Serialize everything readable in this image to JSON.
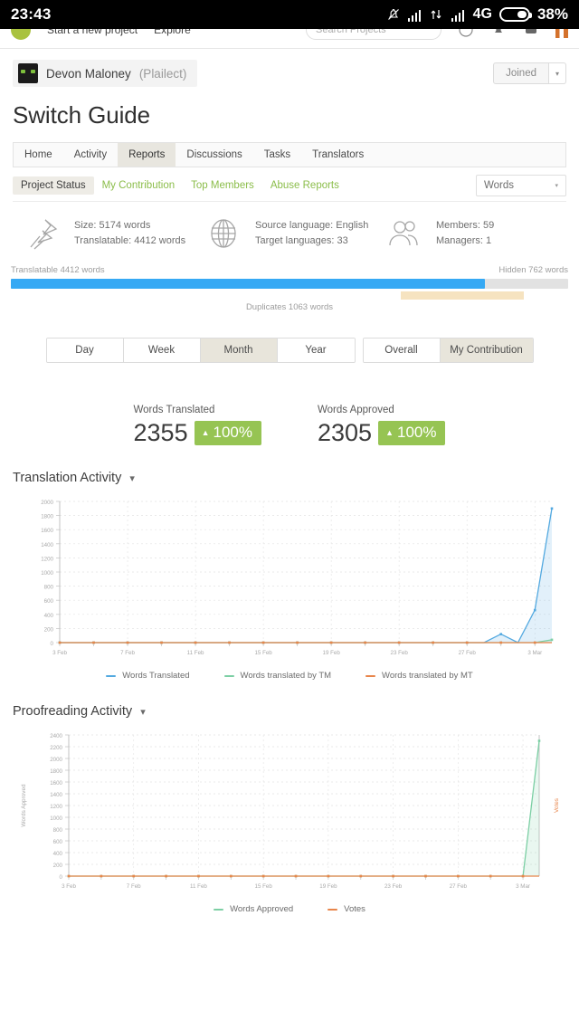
{
  "statusbar": {
    "time": "23:43",
    "network": "4G",
    "battery": "38%",
    "icons": [
      "mute-bell-icon",
      "signal-bars-icon",
      "data-transfer-icon",
      "signal-bars-icon",
      "battery-icon"
    ]
  },
  "topnav": {
    "brand": "crowdin-logo",
    "links": [
      "Start a new project",
      "Explore"
    ],
    "search_placeholder": "Search Projects",
    "icons": [
      "help-icon",
      "notifications-icon",
      "messages-icon",
      "flag-icon"
    ]
  },
  "owner": {
    "name": "Devon Maloney",
    "handle": "(Plailect)",
    "joined_label": "Joined",
    "caret": "▾"
  },
  "page": {
    "title": "Switch Guide"
  },
  "tabs": [
    {
      "label": "Home",
      "active": false
    },
    {
      "label": "Activity",
      "active": false
    },
    {
      "label": "Reports",
      "active": true
    },
    {
      "label": "Discussions",
      "active": false
    },
    {
      "label": "Tasks",
      "active": false
    },
    {
      "label": "Translators",
      "active": false
    }
  ],
  "subtabs": [
    {
      "label": "Project Status",
      "active": true
    },
    {
      "label": "My Contribution",
      "active": false
    },
    {
      "label": "Top Members",
      "active": false
    },
    {
      "label": "Abuse Reports",
      "active": false
    }
  ],
  "unit_select": {
    "value": "Words",
    "caret": "▾"
  },
  "stats": [
    {
      "icon": "ruler-pencil-icon",
      "line1": "Size: 5174 words",
      "line2": "Translatable: 4412 words"
    },
    {
      "icon": "globe-icon",
      "line1": "Source language: English",
      "line2": "Target languages: 33"
    },
    {
      "icon": "members-icon",
      "line1": "Members: 59",
      "line2": "Managers: 1"
    }
  ],
  "progress": {
    "left_label": "Translatable 4412 words",
    "right_label": "Hidden 762 words",
    "fill_percent": 85,
    "duplicates_label": "Duplicates 1063 words",
    "duplicates_start_percent": 70,
    "duplicates_width_percent": 22,
    "fill_color": "#36a9f4",
    "track_color": "#e2e2e2",
    "duplicates_color": "#f6e3c0"
  },
  "period_toggles": [
    {
      "label": "Day",
      "active": false
    },
    {
      "label": "Week",
      "active": false
    },
    {
      "label": "Month",
      "active": true
    },
    {
      "label": "Year",
      "active": false
    }
  ],
  "scope_toggles": [
    {
      "label": "Overall",
      "active": false
    },
    {
      "label": "My Contribution",
      "active": true
    }
  ],
  "kpis": [
    {
      "label": "Words Translated",
      "value": "2355",
      "delta": "100%",
      "arrow": "▲",
      "color": "#96c453"
    },
    {
      "label": "Words Approved",
      "value": "2305",
      "delta": "100%",
      "arrow": "▲",
      "color": "#96c453"
    }
  ],
  "chart_data": [
    {
      "type": "line",
      "title": "Translation Activity",
      "chevron": "⌄",
      "xlabel": "",
      "ylabel": "",
      "ylim": [
        0,
        2000
      ],
      "yticks": [
        0,
        200,
        400,
        600,
        800,
        1000,
        1200,
        1400,
        1600,
        1800,
        2000
      ],
      "xticklabels": [
        "3 Feb",
        "7 Feb",
        "11 Feb",
        "15 Feb",
        "19 Feb",
        "23 Feb",
        "27 Feb",
        "3 Mar"
      ],
      "x": [
        "3 Feb",
        "4 Feb",
        "5 Feb",
        "6 Feb",
        "7 Feb",
        "8 Feb",
        "9 Feb",
        "10 Feb",
        "11 Feb",
        "12 Feb",
        "13 Feb",
        "14 Feb",
        "15 Feb",
        "16 Feb",
        "17 Feb",
        "18 Feb",
        "19 Feb",
        "20 Feb",
        "21 Feb",
        "22 Feb",
        "23 Feb",
        "24 Feb",
        "25 Feb",
        "26 Feb",
        "27 Feb",
        "28 Feb",
        "1 Mar",
        "2 Mar",
        "3 Mar",
        "4 Mar"
      ],
      "grid": true,
      "legend_position": "bottom",
      "series": [
        {
          "name": "Words Translated",
          "color": "#53a9e0",
          "values": [
            0,
            0,
            0,
            0,
            0,
            0,
            0,
            0,
            0,
            0,
            0,
            0,
            0,
            0,
            0,
            0,
            0,
            0,
            0,
            0,
            0,
            0,
            0,
            0,
            0,
            0,
            120,
            0,
            460,
            1900
          ]
        },
        {
          "name": "Words translated by TM",
          "color": "#7ccfa4",
          "values": [
            0,
            0,
            0,
            0,
            0,
            0,
            0,
            0,
            0,
            0,
            0,
            0,
            0,
            0,
            0,
            0,
            0,
            0,
            0,
            0,
            0,
            0,
            0,
            0,
            0,
            0,
            0,
            0,
            0,
            40
          ]
        },
        {
          "name": "Words translated by MT",
          "color": "#e8854a",
          "values": [
            0,
            0,
            0,
            0,
            0,
            0,
            0,
            0,
            0,
            0,
            0,
            0,
            0,
            0,
            0,
            0,
            0,
            0,
            0,
            0,
            0,
            0,
            0,
            0,
            0,
            0,
            0,
            0,
            0,
            0
          ]
        }
      ]
    },
    {
      "type": "line",
      "title": "Proofreading Activity",
      "chevron": "⌄",
      "xlabel": "",
      "ylabel": "Words Approved",
      "ylabel_right": "Votes",
      "ylim": [
        0,
        2400
      ],
      "yticks": [
        0,
        200,
        400,
        600,
        800,
        1000,
        1200,
        1400,
        1600,
        1800,
        2000,
        2200,
        2400
      ],
      "xticklabels": [
        "3 Feb",
        "7 Feb",
        "11 Feb",
        "15 Feb",
        "19 Feb",
        "23 Feb",
        "27 Feb",
        "3 Mar"
      ],
      "x": [
        "3 Feb",
        "4 Feb",
        "5 Feb",
        "6 Feb",
        "7 Feb",
        "8 Feb",
        "9 Feb",
        "10 Feb",
        "11 Feb",
        "12 Feb",
        "13 Feb",
        "14 Feb",
        "15 Feb",
        "16 Feb",
        "17 Feb",
        "18 Feb",
        "19 Feb",
        "20 Feb",
        "21 Feb",
        "22 Feb",
        "23 Feb",
        "24 Feb",
        "25 Feb",
        "26 Feb",
        "27 Feb",
        "28 Feb",
        "1 Mar",
        "2 Mar",
        "3 Mar",
        "4 Mar"
      ],
      "grid": true,
      "legend_position": "bottom",
      "series": [
        {
          "name": "Words Approved",
          "color": "#7ccfa4",
          "values": [
            0,
            0,
            0,
            0,
            0,
            0,
            0,
            0,
            0,
            0,
            0,
            0,
            0,
            0,
            0,
            0,
            0,
            0,
            0,
            0,
            0,
            0,
            0,
            0,
            0,
            0,
            0,
            0,
            0,
            2300
          ]
        },
        {
          "name": "Votes",
          "color": "#e8854a",
          "values": [
            0,
            0,
            0,
            0,
            0,
            0,
            0,
            0,
            0,
            0,
            0,
            0,
            0,
            0,
            0,
            0,
            0,
            0,
            0,
            0,
            0,
            0,
            0,
            0,
            0,
            0,
            0,
            0,
            0,
            0
          ]
        }
      ]
    }
  ]
}
